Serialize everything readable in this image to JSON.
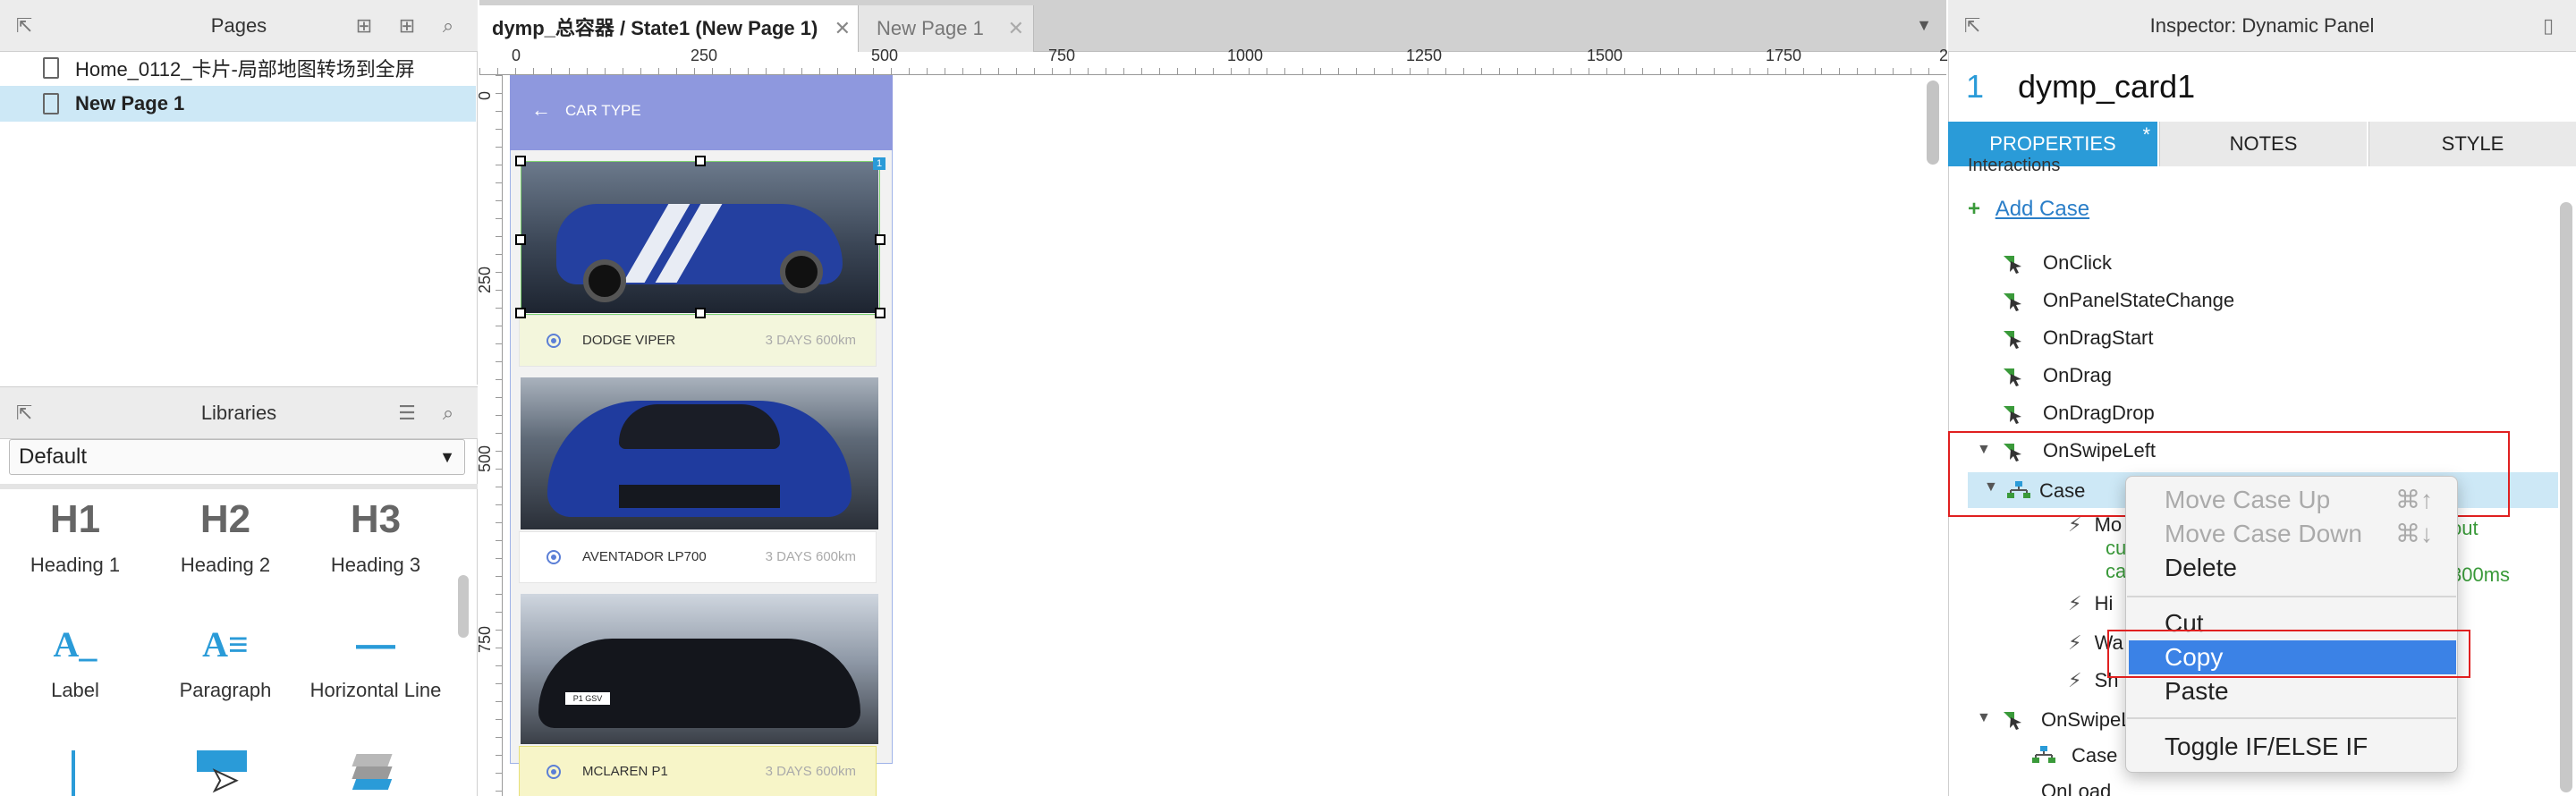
{
  "pages_panel": {
    "title": "Pages",
    "items": [
      {
        "label": "Home_0112_卡片-局部地图转场到全屏",
        "selected": false
      },
      {
        "label": "New Page 1",
        "selected": true
      }
    ]
  },
  "libraries_panel": {
    "title": "Libraries",
    "dropdown_value": "Default",
    "items": [
      {
        "glyph": "H1",
        "label": "Heading 1"
      },
      {
        "glyph": "H2",
        "label": "Heading 2"
      },
      {
        "glyph": "H3",
        "label": "Heading 3"
      },
      {
        "glyph": "A_",
        "label": "Label"
      },
      {
        "glyph": "A≡",
        "label": "Paragraph"
      },
      {
        "glyph": "—",
        "label": "Horizontal Line"
      }
    ]
  },
  "tabs": [
    {
      "label": "dymp_总容器 / State1 (New Page 1)",
      "active": true
    },
    {
      "label": "New Page 1",
      "active": false
    }
  ],
  "ruler": {
    "h_ticks": [
      "0",
      "250",
      "500",
      "750",
      "1000",
      "1250",
      "1500",
      "1750",
      "2"
    ],
    "v_ticks": [
      "0",
      "250",
      "500",
      "750"
    ]
  },
  "canvas": {
    "header_title": "CAR TYPE",
    "cars": [
      {
        "name": "DODGE VIPER",
        "meta": "3 DAYS 600km"
      },
      {
        "name": "AVENTADOR LP700",
        "meta": "3 DAYS 600km"
      },
      {
        "name": "MCLAREN P1",
        "meta": "3 DAYS 600km"
      }
    ],
    "plate_text": "P1 GSV",
    "corner_badge": "1"
  },
  "inspector": {
    "title": "Inspector: Dynamic Panel",
    "widget_index": "1",
    "widget_name": "dymp_card1",
    "tabs": [
      {
        "label": "PROPERTIES",
        "active": true,
        "modified": "*"
      },
      {
        "label": "NOTES",
        "active": false
      },
      {
        "label": "STYLE",
        "active": false
      }
    ],
    "section_label": "Interactions",
    "add_case": "Add Case",
    "events": [
      "OnClick",
      "OnPanelStateChange",
      "OnDragStart",
      "OnDrag",
      "OnDragDrop",
      "OnSwipeLeft"
    ],
    "case_label": "Case",
    "actions": [
      {
        "prefix": "Mo",
        "lines": [
          "cu",
          "ca"
        ]
      },
      {
        "prefix": "Hi"
      },
      {
        "prefix": "Wa"
      },
      {
        "prefix": "Sh"
      }
    ],
    "action_tail": [
      "out",
      "300ms"
    ],
    "next_event": "OnSwipeL",
    "next_case": "Case",
    "last_event": "OnLoad"
  },
  "context_menu": {
    "items": [
      {
        "label": "Move Case Up",
        "shortcut": "⌘↑",
        "disabled": true
      },
      {
        "label": "Move Case Down",
        "shortcut": "⌘↓",
        "disabled": true
      },
      {
        "label": "Delete",
        "disabled": false
      },
      {
        "label": "Cut",
        "disabled": false
      },
      {
        "label": "Copy",
        "disabled": false,
        "highlighted": true
      },
      {
        "label": "Paste",
        "disabled": false
      },
      {
        "label": "Toggle IF/ELSE IF",
        "disabled": false
      }
    ]
  },
  "colors": {
    "accent_blue": "#2a9bd8",
    "highlight_blue": "#3b82e6",
    "selection_row": "#cde8f6",
    "annotation_red": "#e02020",
    "header_purple": "#8e98de",
    "event_green": "#3a9a3a"
  }
}
